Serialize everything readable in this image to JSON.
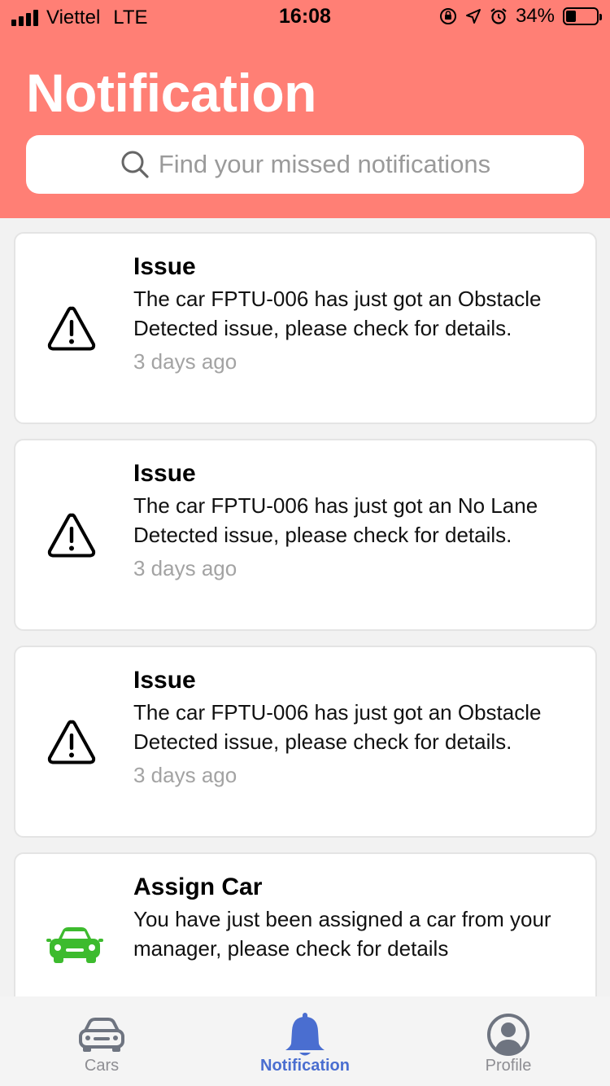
{
  "status_bar": {
    "carrier": "Viettel",
    "network": "LTE",
    "time": "16:08",
    "battery_percent_text": "34%",
    "battery_level": 0.34
  },
  "header": {
    "title": "Notification",
    "search_placeholder": "Find your missed notifications",
    "background_color": "#ff7f75"
  },
  "notifications": [
    {
      "icon": "warning-icon",
      "title": "Issue",
      "message": "The car FPTU-006 has just got an Obstacle Detected issue, please check for details.",
      "time": "3 days ago"
    },
    {
      "icon": "warning-icon",
      "title": "Issue",
      "message": "The car FPTU-006 has just got an No Lane Detected issue, please check for details.",
      "time": "3 days ago"
    },
    {
      "icon": "warning-icon",
      "title": "Issue",
      "message": "The car FPTU-006 has just got an Obstacle Detected issue, please check for details.",
      "time": "3 days ago"
    },
    {
      "icon": "car-icon",
      "title": "Assign Car",
      "message": "You have just been assigned a car from your manager, please check for details",
      "time": ""
    }
  ],
  "tabs": [
    {
      "label": "Cars",
      "icon": "car-icon",
      "active": false
    },
    {
      "label": "Notification",
      "icon": "bell-icon",
      "active": true
    },
    {
      "label": "Profile",
      "icon": "profile-icon",
      "active": false
    }
  ],
  "colors": {
    "accent": "#4a6ed0",
    "car_green": "#3dbb2e",
    "inactive": "#6e7480"
  }
}
